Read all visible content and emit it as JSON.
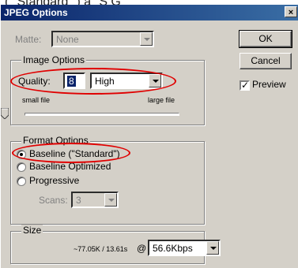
{
  "cropped_header_fragment": "( \"Standard\" ) a \"S  G   \"  \"  \"",
  "window": {
    "title": "JPEG Options",
    "close_glyph": "×"
  },
  "matte": {
    "label": "Matte:",
    "value": "None"
  },
  "image_options": {
    "title": "Image Options",
    "quality_label": "Quality:",
    "quality_value": "8",
    "quality_preset": "High",
    "slider_left_label": "small file",
    "slider_right_label": "large file",
    "slider_level": 0.67
  },
  "format_options": {
    "title": "Format Options",
    "options": [
      "Baseline (\"Standard\")",
      "Baseline Optimized",
      "Progressive"
    ],
    "selected_index": 0,
    "scans_label": "Scans:",
    "scans_value": "3"
  },
  "size": {
    "title": "Size",
    "estimate": "~77.05K / 13.61s",
    "at_symbol": "@",
    "connection": "56.6Kbps"
  },
  "buttons": {
    "ok": "OK",
    "cancel": "Cancel"
  },
  "preview": {
    "label": "Preview",
    "checked": true,
    "check_glyph": "✓"
  },
  "colors": {
    "title_start": "#0a246a",
    "title_end": "#3a6ea5",
    "highlight_ellipse": "#e00000",
    "dialog_bg": "#d4d0c8"
  }
}
